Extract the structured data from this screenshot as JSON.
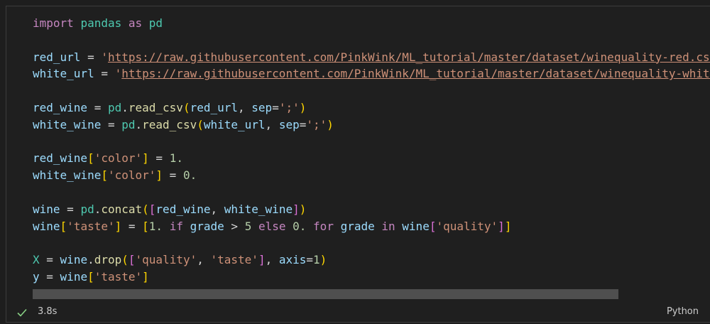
{
  "code_lines": [
    [
      {
        "t": "import",
        "c": "kw"
      },
      {
        "t": " ",
        "c": "op"
      },
      {
        "t": "pandas",
        "c": "mod"
      },
      {
        "t": " ",
        "c": "op"
      },
      {
        "t": "as",
        "c": "kw"
      },
      {
        "t": " ",
        "c": "op"
      },
      {
        "t": "pd",
        "c": "mod"
      }
    ],
    [],
    [
      {
        "t": "red_url",
        "c": "var"
      },
      {
        "t": " = ",
        "c": "op"
      },
      {
        "t": "'",
        "c": "str"
      },
      {
        "t": "https://raw.githubusercontent.com/PinkWink/ML_tutorial/master/dataset/winequality-red.csv",
        "c": "url"
      },
      {
        "t": "'",
        "c": "str"
      }
    ],
    [
      {
        "t": "white_url",
        "c": "var"
      },
      {
        "t": " = ",
        "c": "op"
      },
      {
        "t": "'",
        "c": "str"
      },
      {
        "t": "https://raw.githubusercontent.com/PinkWink/ML_tutorial/master/dataset/winequality-white.csv",
        "c": "url"
      },
      {
        "t": "'",
        "c": "str"
      }
    ],
    [],
    [
      {
        "t": "red_wine",
        "c": "var"
      },
      {
        "t": " = ",
        "c": "op"
      },
      {
        "t": "pd",
        "c": "mod"
      },
      {
        "t": ".",
        "c": "op"
      },
      {
        "t": "read_csv",
        "c": "fn"
      },
      {
        "t": "(",
        "c": "b1"
      },
      {
        "t": "red_url",
        "c": "var"
      },
      {
        "t": ", ",
        "c": "op"
      },
      {
        "t": "sep",
        "c": "var"
      },
      {
        "t": "=",
        "c": "op"
      },
      {
        "t": "';'",
        "c": "str"
      },
      {
        "t": ")",
        "c": "b1"
      }
    ],
    [
      {
        "t": "white_wine",
        "c": "var"
      },
      {
        "t": " = ",
        "c": "op"
      },
      {
        "t": "pd",
        "c": "mod"
      },
      {
        "t": ".",
        "c": "op"
      },
      {
        "t": "read_csv",
        "c": "fn"
      },
      {
        "t": "(",
        "c": "b1"
      },
      {
        "t": "white_url",
        "c": "var"
      },
      {
        "t": ", ",
        "c": "op"
      },
      {
        "t": "sep",
        "c": "var"
      },
      {
        "t": "=",
        "c": "op"
      },
      {
        "t": "';'",
        "c": "str"
      },
      {
        "t": ")",
        "c": "b1"
      }
    ],
    [],
    [
      {
        "t": "red_wine",
        "c": "var"
      },
      {
        "t": "[",
        "c": "b1"
      },
      {
        "t": "'color'",
        "c": "str"
      },
      {
        "t": "]",
        "c": "b1"
      },
      {
        "t": " = ",
        "c": "op"
      },
      {
        "t": "1.",
        "c": "num"
      }
    ],
    [
      {
        "t": "white_wine",
        "c": "var"
      },
      {
        "t": "[",
        "c": "b1"
      },
      {
        "t": "'color'",
        "c": "str"
      },
      {
        "t": "]",
        "c": "b1"
      },
      {
        "t": " = ",
        "c": "op"
      },
      {
        "t": "0.",
        "c": "num"
      }
    ],
    [],
    [
      {
        "t": "wine",
        "c": "var"
      },
      {
        "t": " = ",
        "c": "op"
      },
      {
        "t": "pd",
        "c": "mod"
      },
      {
        "t": ".",
        "c": "op"
      },
      {
        "t": "concat",
        "c": "fn"
      },
      {
        "t": "(",
        "c": "b1"
      },
      {
        "t": "[",
        "c": "b2"
      },
      {
        "t": "red_wine",
        "c": "var"
      },
      {
        "t": ", ",
        "c": "op"
      },
      {
        "t": "white_wine",
        "c": "var"
      },
      {
        "t": "]",
        "c": "b2"
      },
      {
        "t": ")",
        "c": "b1"
      }
    ],
    [
      {
        "t": "wine",
        "c": "var"
      },
      {
        "t": "[",
        "c": "b1"
      },
      {
        "t": "'taste'",
        "c": "str"
      },
      {
        "t": "]",
        "c": "b1"
      },
      {
        "t": " = ",
        "c": "op"
      },
      {
        "t": "[",
        "c": "b1"
      },
      {
        "t": "1.",
        "c": "num"
      },
      {
        "t": " ",
        "c": "op"
      },
      {
        "t": "if",
        "c": "kw"
      },
      {
        "t": " grade ",
        "c": "var"
      },
      {
        "t": ">",
        "c": "op"
      },
      {
        "t": " ",
        "c": "op"
      },
      {
        "t": "5",
        "c": "num"
      },
      {
        "t": " ",
        "c": "op"
      },
      {
        "t": "else",
        "c": "kw"
      },
      {
        "t": " ",
        "c": "op"
      },
      {
        "t": "0.",
        "c": "num"
      },
      {
        "t": " ",
        "c": "op"
      },
      {
        "t": "for",
        "c": "kw"
      },
      {
        "t": " grade ",
        "c": "var"
      },
      {
        "t": "in",
        "c": "kw"
      },
      {
        "t": " wine",
        "c": "var"
      },
      {
        "t": "[",
        "c": "b2"
      },
      {
        "t": "'quality'",
        "c": "str"
      },
      {
        "t": "]",
        "c": "b2"
      },
      {
        "t": "]",
        "c": "b1"
      }
    ],
    [],
    [
      {
        "t": "X",
        "c": "mod"
      },
      {
        "t": " = ",
        "c": "op"
      },
      {
        "t": "wine",
        "c": "var"
      },
      {
        "t": ".",
        "c": "op"
      },
      {
        "t": "drop",
        "c": "fn"
      },
      {
        "t": "(",
        "c": "b1"
      },
      {
        "t": "[",
        "c": "b2"
      },
      {
        "t": "'quality'",
        "c": "str"
      },
      {
        "t": ", ",
        "c": "op"
      },
      {
        "t": "'taste'",
        "c": "str"
      },
      {
        "t": "]",
        "c": "b2"
      },
      {
        "t": ", ",
        "c": "op"
      },
      {
        "t": "axis",
        "c": "var"
      },
      {
        "t": "=",
        "c": "op"
      },
      {
        "t": "1",
        "c": "num"
      },
      {
        "t": ")",
        "c": "b1"
      }
    ],
    [
      {
        "t": "y",
        "c": "var"
      },
      {
        "t": " = ",
        "c": "op"
      },
      {
        "t": "wine",
        "c": "var"
      },
      {
        "t": "[",
        "c": "b1"
      },
      {
        "t": "'taste'",
        "c": "str"
      },
      {
        "t": "]",
        "c": "b1"
      }
    ]
  ],
  "status": {
    "check_icon": "check-icon",
    "execution_time": "3.8s",
    "language": "Python"
  },
  "colors": {
    "background": "#1e1e1e",
    "success": "#89d185"
  }
}
